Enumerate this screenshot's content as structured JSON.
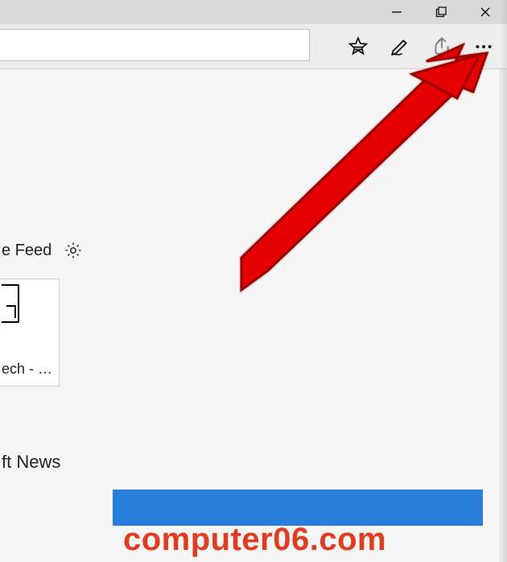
{
  "window": {
    "controls": {
      "minimize": "minimize",
      "maximize": "maximize",
      "close": "close"
    }
  },
  "toolbar": {
    "favorites_icon": "add-to-favorites-reading-list",
    "notes_icon": "add-notes",
    "share_icon": "share",
    "more_icon": "settings-and-more"
  },
  "content": {
    "feed_toggle_label": "e Feed",
    "feed_settings_icon": "settings",
    "tile_label": "ech - …",
    "section_heading": "ft News"
  },
  "watermark": {
    "text": "computer06.com"
  }
}
